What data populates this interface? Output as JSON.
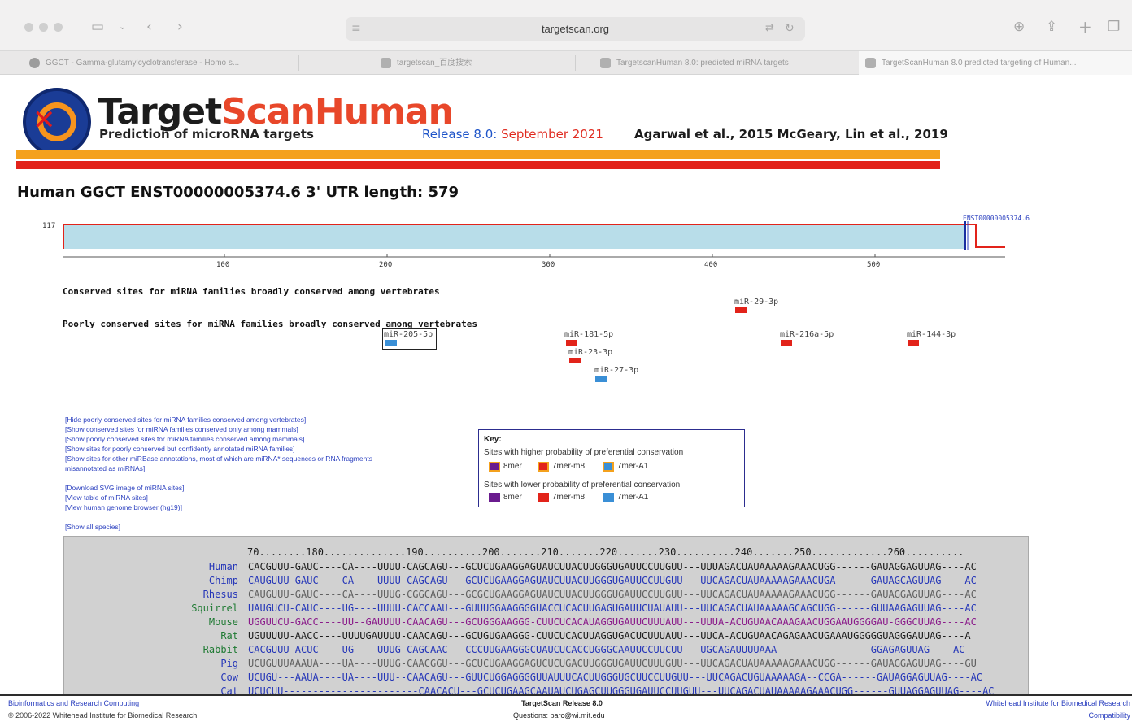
{
  "browser": {
    "url": "targetscan.org",
    "tabs": [
      {
        "label": "GGCT - Gamma-glutamylcyclotransferase - Homo s..."
      },
      {
        "label": "targetscan_百度搜索"
      },
      {
        "label": "TargetscanHuman 8.0: predicted miRNA targets"
      },
      {
        "label": "TargetScanHuman 8.0 predicted targeting of Human..."
      }
    ]
  },
  "header": {
    "title_part1": "Target",
    "title_part2": "Scan",
    "title_part3": "Human",
    "subtitle": "Prediction of microRNA targets",
    "release_label": "Release 8.0:",
    "release_date": "September 2021",
    "citation": "Agarwal et al., 2015   McGeary, Lin et al., 2019"
  },
  "gene": {
    "title": "Human GGCT  ENST00000005374.6   3' UTR length: 579",
    "transcript_label": "ENST00000005374.6",
    "profile_max": "117",
    "axis_ticks": [
      "100",
      "200",
      "300",
      "400",
      "500"
    ]
  },
  "sections": {
    "conserved": "Conserved sites for miRNA families broadly conserved among vertebrates",
    "poorly_conserved": "Poorly conserved sites for miRNA families broadly conserved among vertebrates"
  },
  "mirnas": {
    "mir29": "miR-29-3p",
    "mir205": "miR-205-5p",
    "mir181": "miR-181-5p",
    "mir23": "miR-23-3p",
    "mir27": "miR-27-3p",
    "mir216a": "miR-216a-5p",
    "mir144": "miR-144-3p"
  },
  "links": {
    "l1": "[Hide poorly conserved sites for miRNA families conserved among vertebrates]",
    "l2": "[Show conserved sites for miRNA families conserved only among mammals]",
    "l3": "[Show poorly conserved sites for miRNA families conserved among mammals]",
    "l4": "[Show sites for poorly conserved but confidently annotated miRNA families]",
    "l5a": "[Show sites for other miRBase annotations, most of which are miRNA* sequences or RNA fragments",
    "l5b": "misannotated as miRNAs]",
    "l6": "[Download SVG image of miRNA sites]",
    "l7": "[View table of miRNA sites]",
    "l8": "[View human genome browser (hg19)]",
    "l9": "[Show all species]"
  },
  "key": {
    "title": "Key:",
    "higher": "Sites with higher probability of preferential conservation",
    "lower": "Sites with lower probability of preferential conservation",
    "t8mer": "8mer",
    "t7merm8": "7mer-m8",
    "t7mera1": "7mer-A1"
  },
  "alignment": {
    "ruler": "70........180..............190..........200.......210.......220.......230..........240.......250.............260..........",
    "rows": [
      {
        "species": "Human",
        "seq": "CACGUUU-GAUC----CA----UUUU-CAGCAGU---GCUCUGAAGGAGUAUCUUACUUGGGUGAUUCCUUGUU---UUUAGACUAUAAAAAGAAACUGG------GAUAGGAGUUAG----AC"
      },
      {
        "species": "Chimp",
        "seq": "CAUGUUU-GAUC----CA----UUUU-CAGCAGU---GCUCUGAAGGAGUAUCUUACUUGGGUGAUUCCUUGUU---UUCAGACUAUAAAAAGAAACUGA------GAUAGCAGUUAG----AC"
      },
      {
        "species": "Rhesus",
        "seq": "CAUGUUU-GAUC----CA----UUUG-CGGCAGU---GCGCUGAAGGAGUAUCUUACUUGGGUGAUUCCUUGUU---UUCAGACUAUAAAAAGAAACUGG------GAUAGGAGUUAG----AC"
      },
      {
        "species": "Squirrel",
        "seq": "UAUGUCU-CAUC----UG----UUUU-CACCAAU---GUUUGGAAGGGGUACCUCACUUGAGUGAUUCUAUAUU---UUCAGACUAUAAAAAGCAGCUGG------GUUAAGAGUUAG----AC"
      },
      {
        "species": "Mouse",
        "seq": "UGGUUCU-GACC----UU--GAUUUU-CAACAGU---GCUGGGAAGGG-CUUCUCACAUAGGUGAUUCUUUAUU---UUUA-ACUGUAACAAAGAACUGGAAUGGGGAU-GGGCUUAG----AC"
      },
      {
        "species": "Rat",
        "seq": "UGUUUUU-AACC----UUUUGAUUUU-CAACAGU---GCUGUGAAGGG-CUUCUCACUUAGGUGACUCUUUAUU---UUCA-ACUGUAACAGAGAACUGAAAUGGGGGUAGGGAUUAG----A"
      },
      {
        "species": "Rabbit",
        "seq": "CACGUUU-ACUC----UG----UUUG-CAGCAAC---CCCUUGAAGGGCUAUCUCACCUGGGCAAUUCCUUCUU---UGCAGAUUUUAAA----------------GGAGAGUUAG----AC"
      },
      {
        "species": "Pig",
        "seq": "UCUGUUUAAAUA----UA----UUUG-CAACGGU---GCUCUGAAGGAGUCUCUGACUUGGGUGAUUCUUUGUU---UUCAGACUAUAAAAAGAAACUGG------GAUAGGAGUUAG----GU"
      },
      {
        "species": "Cow",
        "seq": "UCUGU---AAUA----UA----UUU--CAACAGU---GUUCUGGAGGGGUUAUUUCACUUGGGUGCUUCCUUGUU---UUCAGACUGUAAAAAGA--CCGA------GAUAGGAGUUAG----AC"
      },
      {
        "species": "Cat",
        "seq": "UCUCUU-----------------------CAACACU---GCUCUGAAGCAAUAUCUGAGCUUGGGUGAUUCCUUGUU---UUCAGACUAUAAAAAGAAACUGG------GUUAGGAGUUAG----AC"
      }
    ]
  },
  "footer": {
    "left1": "Bioinformatics and Research Computing",
    "left2": "© 2006-2022 Whitehead Institute for Biomedical Research",
    "center1": "TargetScan Release 8.0",
    "center2": "Questions: barc@wi.mit.edu",
    "right1": "Whitehead Institute for Biomedical Research",
    "right2": "Compatibility"
  },
  "colors": {
    "orange": "#f4a11d",
    "red": "#e2231a",
    "site_blue": "#3a8fd6",
    "purple": "#6a1b8e",
    "link_blue": "#2a3fbf"
  }
}
